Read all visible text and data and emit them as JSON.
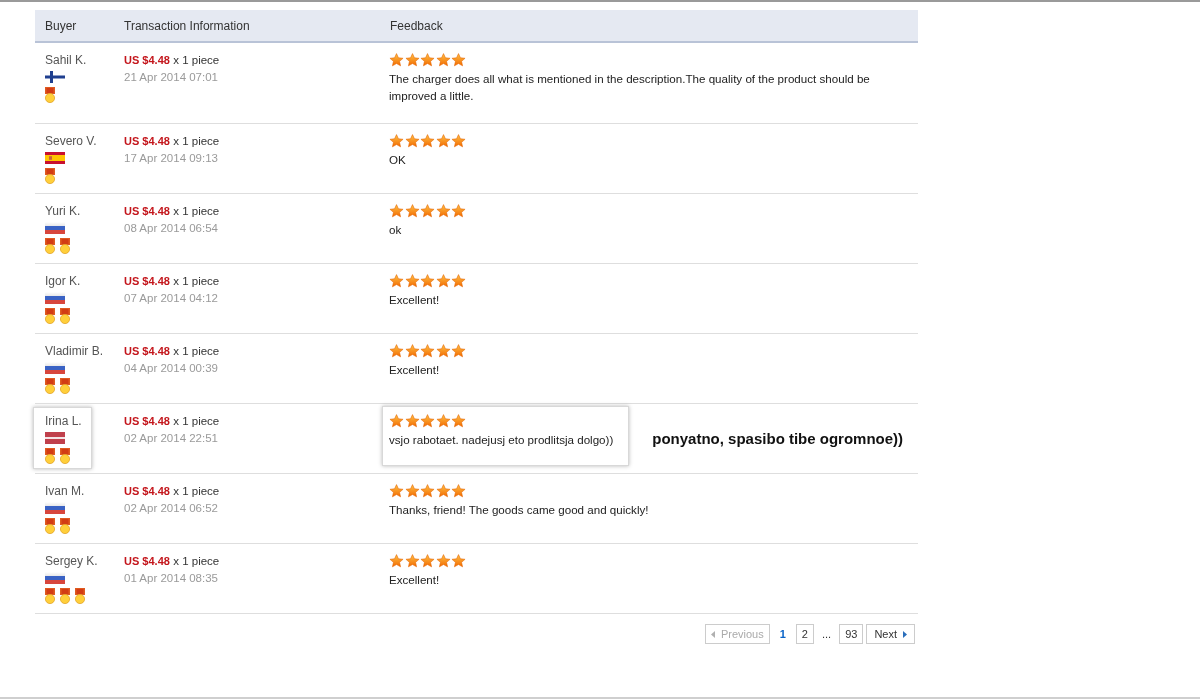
{
  "table": {
    "columns": [
      "Buyer",
      "Transaction Information",
      "Feedback"
    ],
    "rows": [
      {
        "buyer": "Sahil K.",
        "flag": {
          "kind": "finland"
        },
        "medals": [
          {
            "kind": "medal"
          }
        ],
        "price": "US $4.48",
        "quantity": "x 1 piece",
        "date": "21 Apr 2014 07:01",
        "stars": 5,
        "feedback": "The charger does all what is mentioned in the description.The quality of the product should be improved a little.",
        "highlighted": false
      },
      {
        "buyer": "Severo V.",
        "flag": {
          "kind": "spain"
        },
        "medals": [
          {
            "kind": "medal"
          }
        ],
        "price": "US $4.48",
        "quantity": "x 1 piece",
        "date": "17 Apr 2014 09:13",
        "stars": 5,
        "feedback": "OK",
        "highlighted": false
      },
      {
        "buyer": "Yuri K.",
        "flag": {
          "kind": "russia"
        },
        "medals": [
          {
            "kind": "medal"
          },
          {
            "kind": "medal"
          }
        ],
        "price": "US $4.48",
        "quantity": "x 1 piece",
        "date": "08 Apr 2014 06:54",
        "stars": 5,
        "feedback": "ok",
        "highlighted": false
      },
      {
        "buyer": "Igor K.",
        "flag": {
          "kind": "russia"
        },
        "medals": [
          {
            "kind": "medal"
          },
          {
            "kind": "medal"
          }
        ],
        "price": "US $4.48",
        "quantity": "x 1 piece",
        "date": "07 Apr 2014 04:12",
        "stars": 5,
        "feedback": "Excellent!",
        "highlighted": false
      },
      {
        "buyer": "Vladimir B.",
        "flag": {
          "kind": "russia"
        },
        "medals": [
          {
            "kind": "medal"
          },
          {
            "kind": "medal"
          }
        ],
        "price": "US $4.48",
        "quantity": "x 1 piece",
        "date": "04 Apr 2014 00:39",
        "stars": 5,
        "feedback": "Excellent!",
        "highlighted": false
      },
      {
        "buyer": "Irina L.",
        "flag": {
          "kind": "latvia"
        },
        "medals": [
          {
            "kind": "medal"
          },
          {
            "kind": "medal"
          }
        ],
        "price": "US $4.48",
        "quantity": "x 1 piece",
        "date": "02 Apr 2014 22:51",
        "stars": 5,
        "feedback": "vsjo rabotaet. nadejusj eto prodlitsja dolgo))",
        "highlighted": true,
        "annotation": "ponyatno, spasibo tibe ogromnoe))"
      },
      {
        "buyer": "Ivan M.",
        "flag": {
          "kind": "russia"
        },
        "medals": [
          {
            "kind": "medal"
          },
          {
            "kind": "medal"
          }
        ],
        "price": "US $4.48",
        "quantity": "x 1 piece",
        "date": "02 Apr 2014 06:52",
        "stars": 5,
        "feedback": "Thanks, friend! The goods came good and quickly!",
        "highlighted": false
      },
      {
        "buyer": "Sergey K.",
        "flag": {
          "kind": "russia"
        },
        "medals": [
          {
            "kind": "medal"
          },
          {
            "kind": "medal"
          },
          {
            "kind": "medal"
          }
        ],
        "price": "US $4.48",
        "quantity": "x 1 piece",
        "date": "01 Apr 2014 08:35",
        "stars": 5,
        "feedback": "Excellent!",
        "highlighted": false
      }
    ]
  },
  "pagination": {
    "previous": {
      "label": "Previous",
      "disabled": true
    },
    "pages": [
      {
        "kind": "page",
        "label": "1",
        "selected": true
      },
      {
        "kind": "page",
        "label": "2",
        "selected": false
      },
      {
        "kind": "ellipsis",
        "label": "..."
      },
      {
        "kind": "page",
        "label": "93",
        "selected": false
      }
    ],
    "next": {
      "label": "Next",
      "disabled": false
    }
  }
}
